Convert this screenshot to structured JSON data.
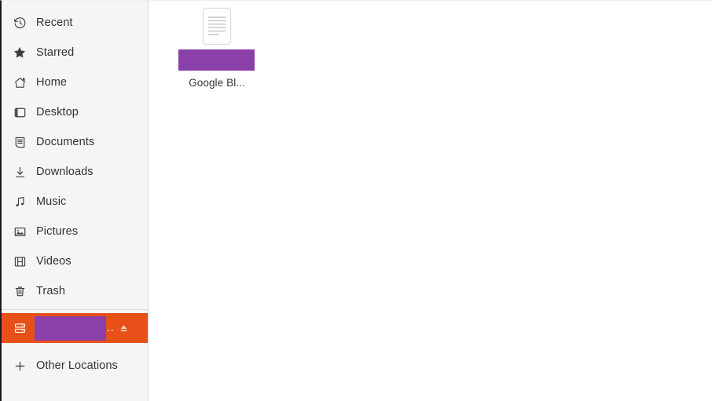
{
  "window": {
    "app": "Files",
    "colors": {
      "sidebar_bg": "#f6f5f4",
      "content_bg": "#ffffff",
      "selection_orange": "#e8501a",
      "redaction_purple": "#8b3fa8",
      "text": "#2e3436"
    }
  },
  "sidebar": {
    "places": [
      {
        "label": "Recent",
        "icon": "clock-history-icon"
      },
      {
        "label": "Starred",
        "icon": "star-icon"
      },
      {
        "label": "Home",
        "icon": "home-icon"
      },
      {
        "label": "Desktop",
        "icon": "desktop-icon"
      },
      {
        "label": "Documents",
        "icon": "documents-icon"
      },
      {
        "label": "Downloads",
        "icon": "download-icon"
      },
      {
        "label": "Music",
        "icon": "music-note-icon"
      },
      {
        "label": "Pictures",
        "icon": "image-icon"
      },
      {
        "label": "Videos",
        "icon": "film-icon"
      },
      {
        "label": "Trash",
        "icon": "trash-icon"
      }
    ],
    "drive": {
      "label": "",
      "label_ellipsis": "..",
      "icon": "harddisk-icon",
      "eject_icon": "eject-icon",
      "selected": true,
      "redacted": true
    },
    "other_locations": {
      "label": "Other Locations",
      "icon": "plus-icon"
    }
  },
  "main": {
    "files": [
      {
        "label": "Google Bl...",
        "icon": "text-document-icon",
        "redacted": true
      }
    ]
  }
}
